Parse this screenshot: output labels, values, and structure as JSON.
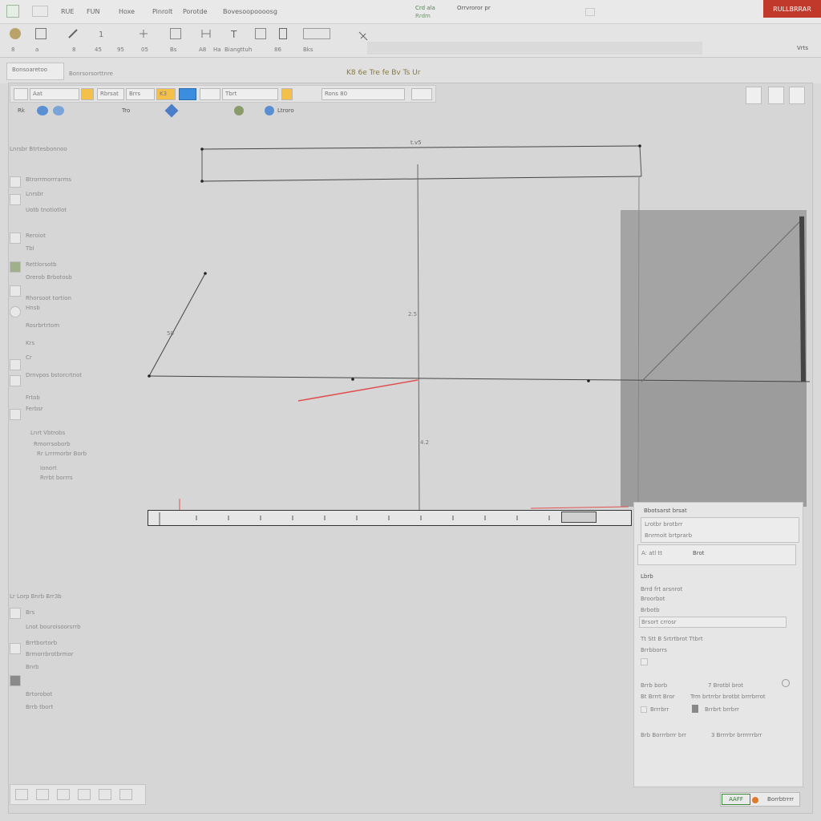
{
  "titlebar": {
    "app_icon": "app-logo-icon",
    "menu": [
      "RUE",
      "FUN",
      "Hoxe",
      "Pinrolt",
      "Porotde",
      "Bovesoopoooosg"
    ],
    "center_text": "Crd ala",
    "center_sub": "Rrdm",
    "center_text2": "Orrvroror pr",
    "badge": "RULLBRRAR"
  },
  "ribbon": {
    "labels": [
      "8",
      "a",
      "8",
      "45",
      "95",
      "05",
      "Bs",
      "A8",
      "Ha",
      "Biangttuh",
      "86",
      "Bks"
    ],
    "right_label": "Vrts"
  },
  "doc": {
    "tab_label": "Bonsoaretoo",
    "header_text": "Bonrsorsorttnre",
    "title_icons": "K8 6e Tre fe Bv Ts Ur"
  },
  "toolbar": {
    "items": [
      "Aat",
      "Rbrsat",
      "Brrs",
      "K3",
      "Tbrt",
      "Rons 80"
    ],
    "row2": [
      "Rk",
      "Tro",
      "Ltroro"
    ]
  },
  "left_panel": {
    "title": "Lnrsbr Btrtesbonnoo",
    "rows": [
      "Btrorrmorrrarms",
      "Lnrsbr",
      "Uotb tnotiotlot",
      "Reroiot",
      "Tbl",
      "Rettlorsotb",
      "Orerob Brbotosb",
      "Rhorsoot tortion",
      "Hnsb",
      "Rosrbrtrtom",
      "Krs",
      "Cr",
      "Drnvpos bstorcrtnot",
      "Frtob",
      "Ferbsr",
      "Lnrt Vbtrobs",
      "Rmorrsoborb",
      "Rr Lrrrmorbr Borb",
      "Ionort",
      "Rrrbt borrrs"
    ],
    "rows2": [
      "Lr Lorp Bnrb Brr3b",
      "Brs",
      "Lnot bouroisoorsrrb",
      "Brrtbortorb",
      "Brmorrbrotbrmor",
      "Bnrb",
      "Brtorobot",
      "Brrb tbort"
    ]
  },
  "canvas": {
    "dim_top": "t.v5",
    "dim_mid": "2.5",
    "dim_angle": "50",
    "dim_low": "4.2"
  },
  "props": {
    "title": "Bbotsarst brsat",
    "line1": "Lrotbr brotbrr",
    "line2": "Bnrmoit brtprarb",
    "sel_label": "A: atl tt",
    "sel_value": "Brot",
    "section": "Lbrb",
    "f1": "Brrd frt arsnrot",
    "f2": "Broorbot",
    "f3": "Brbotb",
    "f4_value": "Brsort crrosr",
    "f5": "Tt Stt B Srtrtbrot Ttbrt",
    "f6": "Brrbborrs",
    "r1a": "Brrb borb",
    "r1b": "7 Brotbl brot",
    "r2a": "Bt Brrrt Bror",
    "r2b": "Trm brtrrbr brotbt brrrbrrot",
    "r3a": "Brrrbrr",
    "r3b": "Brrbrt brrbrr",
    "r4a": "Brb Borrrbrrr brr",
    "r4b": "3 Brrrrbr brrrrrrbrr"
  },
  "bottom": {
    "ok_label": "AAFF",
    "right_label": "Borrbtrrrr"
  }
}
